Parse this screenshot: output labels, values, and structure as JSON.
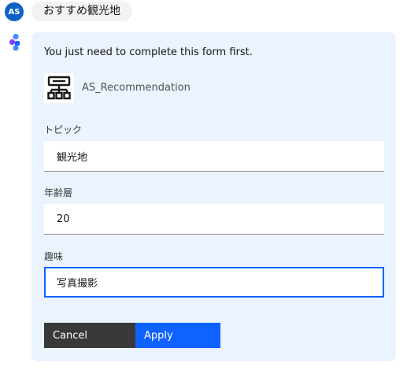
{
  "user": {
    "avatar_initials": "AS",
    "avatar_color": "#0f62c4",
    "message": "おすすめ観光地"
  },
  "bot": {
    "avatar_icon": "bot-avatar-icon"
  },
  "card": {
    "intro": "You just need to complete this form first.",
    "skill": {
      "icon": "flowchart-icon",
      "name": "AS_Recommendation"
    },
    "fields": [
      {
        "label": "トピック",
        "value": "観光地"
      },
      {
        "label": "年齢層",
        "value": "20"
      },
      {
        "label": "趣味",
        "value": "写真撮影",
        "focused": true
      }
    ],
    "buttons": {
      "cancel": "Cancel",
      "apply": "Apply"
    }
  },
  "colors": {
    "card_bg": "#eaf3fe",
    "primary": "#0f62fe",
    "secondary": "#393939"
  }
}
